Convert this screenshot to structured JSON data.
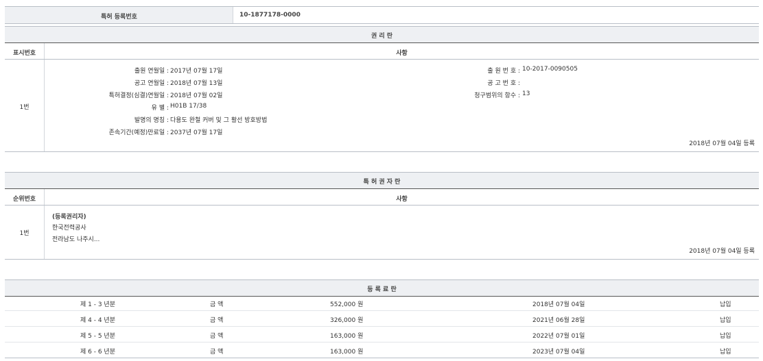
{
  "reg_header": {
    "label": "특허 등록번호",
    "value": "10-1877178-0000"
  },
  "rights": {
    "title": "권 리 란",
    "col_no": "표시번호",
    "col_item": "사항",
    "row_no": "1번",
    "left": [
      {
        "label": "출원 연월일 :",
        "value": "2017년 07월 17일"
      },
      {
        "label": "공고 연월일 :",
        "value": "2018년 07월 13일"
      },
      {
        "label": "특허결정(심결)연월일 :",
        "value": "2018년 07월 02일"
      },
      {
        "label": "유 별 :",
        "value": "H01B 17/38"
      },
      {
        "label": "발명의 명칭 :",
        "value": "다용도 완철 커버 및 그 활선 방호방법"
      },
      {
        "label": "존속기간(예정)만료일 :",
        "value": "2037년 07월 17일"
      }
    ],
    "right": [
      {
        "label": "출 원 번 호 :",
        "value": "10-2017-0090505"
      },
      {
        "label": "공 고 번 호 :",
        "value": ""
      },
      {
        "label": "청구범위의 항수 :",
        "value": "13"
      }
    ],
    "reg_date": "2018년 07월 04일 등록"
  },
  "holders": {
    "title": "특 허 권 자 란",
    "col_no": "순위번호",
    "col_item": "사항",
    "row_no": "1번",
    "lines": [
      "(등록권리자)",
      "한국전력공사",
      "전라남도 나주시..."
    ],
    "reg_date": "2018년 07월 04일 등록"
  },
  "fees": {
    "title": "등 록 료 란",
    "rows": [
      {
        "period": "제 1 - 3 년분",
        "label": "금 액",
        "amount": "552,000 원",
        "date": "2018년 07월 04일",
        "status": "납입"
      },
      {
        "period": "제 4 - 4 년분",
        "label": "금 액",
        "amount": "326,000 원",
        "date": "2021년 06월 28일",
        "status": "납입"
      },
      {
        "period": "제 5 - 5 년분",
        "label": "금 액",
        "amount": "163,000 원",
        "date": "2022년 07월 01일",
        "status": "납입"
      },
      {
        "period": "제 6 - 6 년분",
        "label": "금 액",
        "amount": "163,000 원",
        "date": "2023년 07월 04일",
        "status": "납입"
      }
    ]
  }
}
